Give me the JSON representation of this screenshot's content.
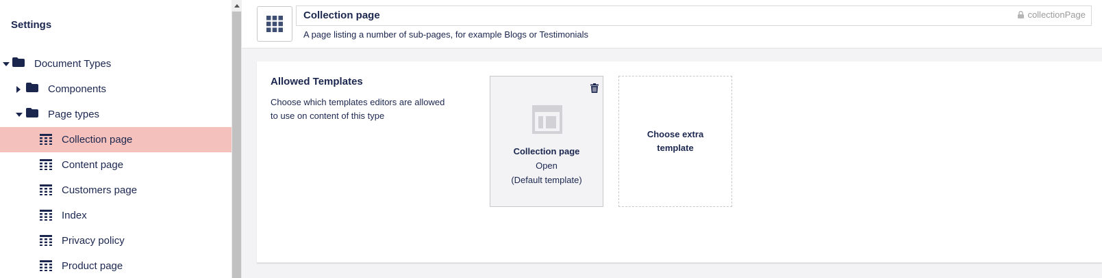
{
  "sidebar": {
    "title": "Settings",
    "tree": [
      {
        "label": "Document Types",
        "icon": "folder-icon",
        "expanded": true,
        "depth": 0
      },
      {
        "label": "Components",
        "icon": "folder-icon",
        "expanded": false,
        "depth": 1
      },
      {
        "label": "Page types",
        "icon": "folder-icon",
        "expanded": true,
        "depth": 1
      },
      {
        "label": "Collection page",
        "icon": "grid-icon",
        "selected": true,
        "depth": 2
      },
      {
        "label": "Content page",
        "icon": "grid-icon",
        "depth": 2
      },
      {
        "label": "Customers page",
        "icon": "grid-icon",
        "depth": 2
      },
      {
        "label": "Index",
        "icon": "grid-icon",
        "depth": 2
      },
      {
        "label": "Privacy policy",
        "icon": "grid-icon",
        "depth": 2
      },
      {
        "label": "Product page",
        "icon": "grid-icon",
        "depth": 2
      }
    ]
  },
  "header": {
    "icon": "grid-icon",
    "name_value": "Collection page",
    "alias": "collectionPage",
    "description": "A page listing a number of sub-pages, for example Blogs or Testimonials"
  },
  "templates": {
    "title": "Allowed Templates",
    "description": "Choose which templates editors are allowed to use on content of this type",
    "items": [
      {
        "name": "Collection page",
        "action": "Open",
        "note": "(Default template)"
      }
    ],
    "add_label": "Choose extra template"
  },
  "colors": {
    "selected_bg": "#f5c1bc",
    "text": "#1b264f",
    "icon_blue": "#3e4f73"
  }
}
